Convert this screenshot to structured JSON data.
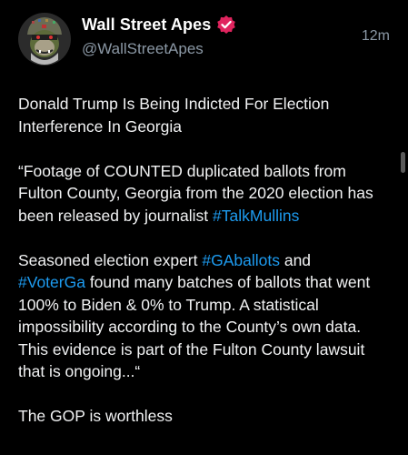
{
  "author": {
    "display_name": "Wall Street Apes",
    "handle": "@WallStreetApes",
    "avatar_icon": "ape-avatar-icon",
    "verified_icon": "verified-badge-icon",
    "verified_color": "#e0245e"
  },
  "timestamp": "12m",
  "post": {
    "p1": "Donald Trump Is Being Indicted For Election Interference In Georgia",
    "p2_text": "“Footage of COUNTED duplicated ballots from Fulton County, Georgia from the 2020 election has been released by journalist ",
    "p2_tag": "#TalkMullins",
    "p3_a": "Seasoned election expert ",
    "p3_tag1": "#GAballots",
    "p3_b": " and ",
    "p3_tag2": "#VoterGa",
    "p3_c": " found many batches of ballots that went 100% to Biden & 0% to Trump. A statistical impossibility according to the County’s own data. This evidence is part of the Fulton County lawsuit that is ongoing...“",
    "p4": "The GOP is worthless"
  },
  "colors": {
    "background": "#000000",
    "text": "#f1f2f3",
    "secondary": "#8b98a5",
    "hashtag": "#1d9bf0"
  }
}
